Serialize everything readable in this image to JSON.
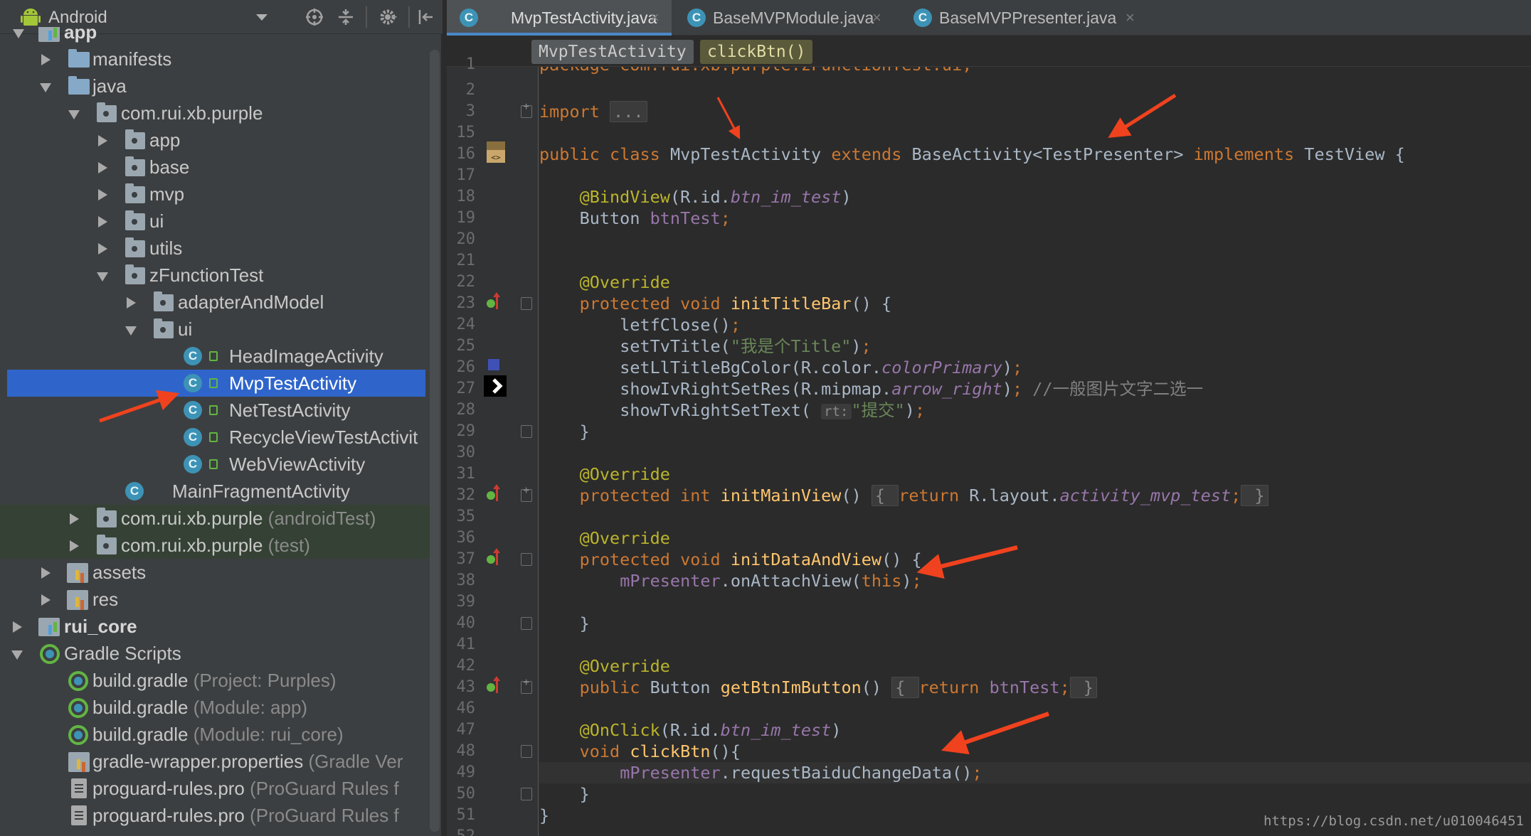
{
  "project_panel": {
    "view_label": "Android",
    "tree": [
      {
        "label": "app",
        "bold": true
      },
      {
        "label": "manifests"
      },
      {
        "label": "java"
      },
      {
        "label": "com.rui.xb.purple"
      },
      {
        "label": "app"
      },
      {
        "label": "base"
      },
      {
        "label": "mvp"
      },
      {
        "label": "ui"
      },
      {
        "label": "utils"
      },
      {
        "label": "zFunctionTest"
      },
      {
        "label": "adapterAndModel"
      },
      {
        "label": "ui"
      },
      {
        "label": "HeadImageActivity"
      },
      {
        "label": "MvpTestActivity"
      },
      {
        "label": "NetTestActivity"
      },
      {
        "label": "RecycleViewTestActivit"
      },
      {
        "label": "WebViewActivity"
      },
      {
        "label": "MainFragmentActivity"
      },
      {
        "label": "com.rui.xb.purple",
        "hint": "(androidTest)"
      },
      {
        "label": "com.rui.xb.purple",
        "hint": "(test)"
      },
      {
        "label": "assets"
      },
      {
        "label": "res"
      },
      {
        "label": "rui_core",
        "bold": true
      },
      {
        "label": "Gradle Scripts"
      },
      {
        "label": "build.gradle",
        "hint": "(Project: Purples)"
      },
      {
        "label": "build.gradle",
        "hint": "(Module: app)"
      },
      {
        "label": "build.gradle",
        "hint": "(Module: rui_core)"
      },
      {
        "label": "gradle-wrapper.properties",
        "hint": "(Gradle Ver"
      },
      {
        "label": "proguard-rules.pro",
        "hint": "(ProGuard Rules f"
      },
      {
        "label": "proguard-rules.pro",
        "hint": "(ProGuard Rules f"
      }
    ]
  },
  "editor": {
    "tabs": [
      {
        "label": "MvpTestActivity.java",
        "active": true
      },
      {
        "label": "BaseMVPModule.java",
        "active": false
      },
      {
        "label": "BaseMVPPresenter.java",
        "active": false
      }
    ],
    "tab_close": "×",
    "breadcrumb": {
      "class_name": "MvpTestActivity",
      "method_name": "clickBtn()"
    },
    "line_numbers": [
      "1",
      "2",
      "3",
      "15",
      "16",
      "17",
      "18",
      "19",
      "20",
      "21",
      "22",
      "23",
      "24",
      "25",
      "26",
      "27",
      "28",
      "29",
      "30",
      "31",
      "32",
      "35",
      "36",
      "37",
      "38",
      "39",
      "40",
      "41",
      "42",
      "43",
      "46",
      "47",
      "48",
      "49",
      "50",
      "51",
      "52"
    ]
  },
  "code": {
    "l1_pkg": "package com.rui.xb.purple.zFunctionTest.ui;",
    "l3_import": "import",
    "l3_fold": "...",
    "l16_public": "public ",
    "l16_class": "class ",
    "l16_name": "MvpTestActivity ",
    "l16_extends": "extends ",
    "l16_base": "BaseActivity<TestPresenter> ",
    "l16_implements": "implements ",
    "l16_view": "TestView {",
    "l18_ann": "@BindView",
    "l18_open": "(R.id.",
    "l18_id": "btn_im_test",
    "l18_close": ")",
    "l19_type": "Button ",
    "l19_field": "btnTest",
    "l19_semi": ";",
    "override": "@Override",
    "protected": "protected ",
    "void": "void ",
    "l23_fn": "initTitleBar",
    "l23_rest": "() {",
    "l24_call": "letfClose()",
    "semi": ";",
    "l25_call": "setTvTitle(",
    "l25_str": "\"我是个Title\"",
    "l25_end": ")",
    "l26_call": "setLlTitleBgColor(R.color.",
    "l26_fd": "colorPrimary",
    "l26_end": ")",
    "l27_call": "showIvRightSetRes(R.mipmap.",
    "l27_fd": "arrow_right",
    "l27_end": ")",
    "l27_comment": " //一般图片文字二选一",
    "l28_call": "showTvRightSetText(",
    "l28_hint": "rt:",
    "l28_str": "\"提交\"",
    "l28_end": ")",
    "close_brace": "}",
    "int": "int ",
    "l32_fn": "initMainView",
    "l32_paren": "() ",
    "l32_lb": "{ ",
    "return": "return ",
    "l32_rl": "R.layout.",
    "l32_fd": "activity_mvp_test",
    "l32_rb": " }",
    "l37_fn": "initDataAndView",
    "l37_rest": "() {",
    "l38_field": "mPresenter",
    "l38_call": ".onAttachView(",
    "this": "this",
    "l38_end": ")",
    "l43_type": "Button ",
    "l43_fn": "getBtnImButton",
    "l43_paren": "() ",
    "l43_lb": "{ ",
    "l43_field": "btnTest",
    "l43_rb": " }",
    "l47_ann": "@OnClick",
    "l47_open": "(R.id.",
    "l47_id": "btn_im_test",
    "l47_close": ")",
    "l48_fn": "clickBtn",
    "l48_rest": "(){",
    "l49_field": "mPresenter",
    "l49_call": ".requestBaiduChangeData()",
    "l50_brace": "}",
    "l51_brace": "}"
  },
  "watermark": "https://blog.csdn.net/u010046451",
  "colors": {
    "selection": "#2f65ca",
    "arrow": "#f0421e",
    "keyword": "#cc7832",
    "annotation": "#bbb529"
  }
}
